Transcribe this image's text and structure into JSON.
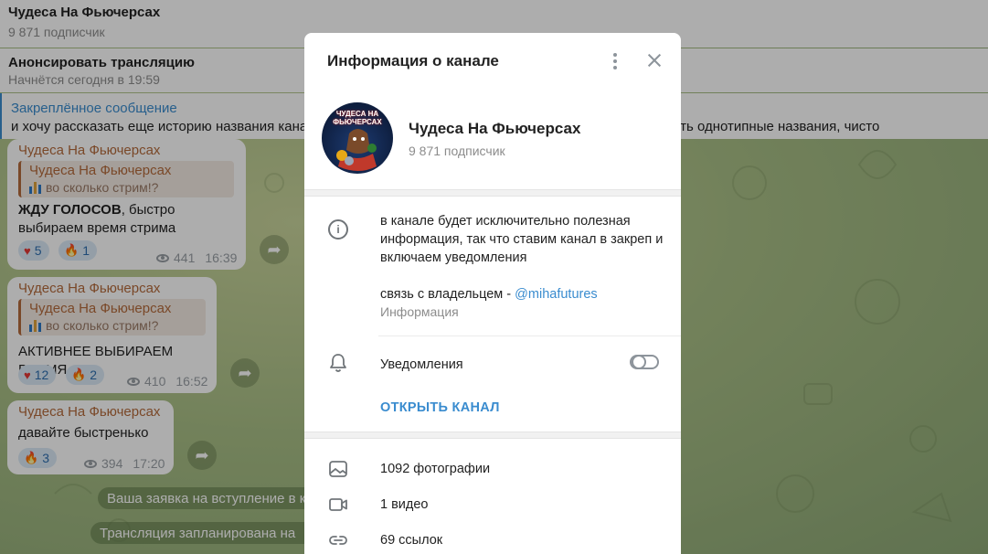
{
  "background": {
    "header": {
      "title": "Чудеса На Фьючерсах",
      "subscribers": "9 871 подписчик"
    },
    "stream_bar": {
      "title": "Анонсировать трансляцию",
      "subtitle": "Начнётся сегодня в 19:59"
    },
    "pinned": {
      "title": "Закреплённое сообщение",
      "text": "и хочу рассказать еще историю названия канала, я постоянно видел и смотрел каналы, и заебался видеть однотипные названия, чисто"
    },
    "messages": [
      {
        "author": "Чудеса На Фьючерсах",
        "reply_author": "Чудеса На Фьючерсах",
        "reply_text": "во сколько стрим!?",
        "text_bold": "ЖДУ ГОЛОСОВ",
        "text": ", быстро выбираем время стрима",
        "reactions": [
          {
            "icon": "heart",
            "count": "5"
          },
          {
            "icon": "fire",
            "count": "1"
          }
        ],
        "views": "441",
        "time": "16:39"
      },
      {
        "author": "Чудеса На Фьючерсах",
        "reply_author": "Чудеса На Фьючерсах",
        "reply_text": "во сколько стрим!?",
        "text": "АКТИВНЕЕ ВЫБИРАЕМ ВРЕМЯ",
        "reactions": [
          {
            "icon": "heart",
            "count": "12"
          },
          {
            "icon": "fire",
            "count": "2"
          }
        ],
        "views": "410",
        "time": "16:52"
      },
      {
        "author": "Чудеса На Фьючерсах",
        "text": "давайте быстренько",
        "reactions": [
          {
            "icon": "fire",
            "count": "3"
          }
        ],
        "views": "394",
        "time": "17:20"
      }
    ],
    "service_messages": [
      "Ваша заявка на вступление в к",
      "Трансляция запланирована на"
    ]
  },
  "modal": {
    "title": "Информация о канале",
    "channel": {
      "name": "Чудеса На Фьючерсах",
      "subscribers": "9 871 подписчик",
      "avatar_text": "ЧУДЕСА НА ФЬЮЧЕРСАХ"
    },
    "description": {
      "line1": "в канале будет исключительно полезная информация, так что ставим канал в закреп и включаем уведомления",
      "contact_prefix": "связь с владельцем - ",
      "contact_link": "@mihafutures",
      "caption": "Информация"
    },
    "notifications": {
      "label": "Уведомления",
      "enabled": false
    },
    "open_channel": "ОТКРЫТЬ КАНАЛ",
    "media": [
      {
        "icon": "photo-icon",
        "label": "1092 фотографии"
      },
      {
        "icon": "video-icon",
        "label": "1 видео"
      },
      {
        "icon": "link-icon",
        "label": "69 ссылок"
      }
    ]
  },
  "colors": {
    "accent": "#3a8ccf",
    "author": "#b46a3b",
    "reaction_bg": "#dbe9f7"
  }
}
